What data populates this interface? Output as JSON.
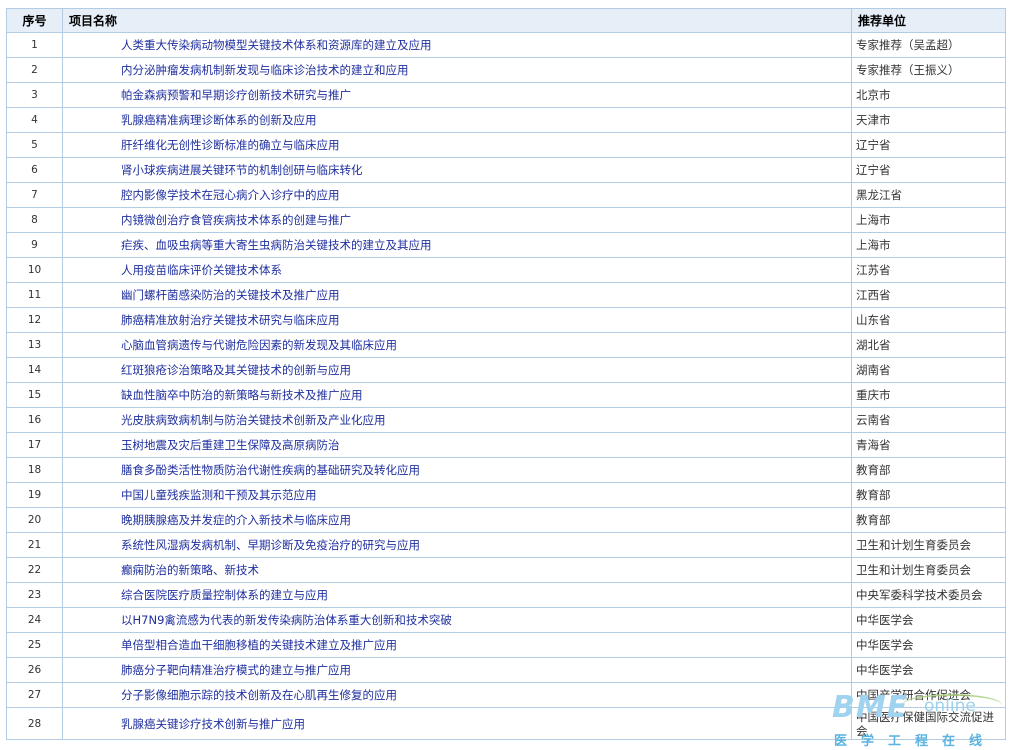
{
  "headers": {
    "no": "序号",
    "name": "项目名称",
    "unit": "推荐单位"
  },
  "rows": [
    {
      "no": "1",
      "name": "人类重大传染病动物模型关键技术体系和资源库的建立及应用",
      "unit": "专家推荐（吴孟超）"
    },
    {
      "no": "2",
      "name": "内分泌肿瘤发病机制新发现与临床诊治技术的建立和应用",
      "unit": "专家推荐（王振义）"
    },
    {
      "no": "3",
      "name": "帕金森病预警和早期诊疗创新技术研究与推广",
      "unit": "北京市"
    },
    {
      "no": "4",
      "name": "乳腺癌精准病理诊断体系的创新及应用",
      "unit": "天津市"
    },
    {
      "no": "5",
      "name": "肝纤维化无创性诊断标准的确立与临床应用",
      "unit": "辽宁省"
    },
    {
      "no": "6",
      "name": "肾小球疾病进展关键环节的机制创研与临床转化",
      "unit": "辽宁省"
    },
    {
      "no": "7",
      "name": "腔内影像学技术在冠心病介入诊疗中的应用",
      "unit": "黑龙江省"
    },
    {
      "no": "8",
      "name": "内镜微创治疗食管疾病技术体系的创建与推广",
      "unit": "上海市"
    },
    {
      "no": "9",
      "name": "疟疾、血吸虫病等重大寄生虫病防治关键技术的建立及其应用",
      "unit": "上海市"
    },
    {
      "no": "10",
      "name": "人用疫苗临床评价关键技术体系",
      "unit": "江苏省"
    },
    {
      "no": "11",
      "name": "幽门螺杆菌感染防治的关键技术及推广应用",
      "unit": "江西省"
    },
    {
      "no": "12",
      "name": "肺癌精准放射治疗关键技术研究与临床应用",
      "unit": "山东省"
    },
    {
      "no": "13",
      "name": "心脑血管病遗传与代谢危险因素的新发现及其临床应用",
      "unit": "湖北省"
    },
    {
      "no": "14",
      "name": "红斑狼疮诊治策略及其关键技术的创新与应用",
      "unit": "湖南省"
    },
    {
      "no": "15",
      "name": "缺血性脑卒中防治的新策略与新技术及推广应用",
      "unit": "重庆市"
    },
    {
      "no": "16",
      "name": "光皮肤病致病机制与防治关键技术创新及产业化应用",
      "unit": "云南省"
    },
    {
      "no": "17",
      "name": "玉树地震及灾后重建卫生保障及高原病防治",
      "unit": "青海省"
    },
    {
      "no": "18",
      "name": "膳食多酚类活性物质防治代谢性疾病的基础研究及转化应用",
      "unit": "教育部"
    },
    {
      "no": "19",
      "name": "中国儿童残疾监测和干预及其示范应用",
      "unit": "教育部"
    },
    {
      "no": "20",
      "name": "晚期胰腺癌及并发症的介入新技术与临床应用",
      "unit": "教育部"
    },
    {
      "no": "21",
      "name": "系统性风湿病发病机制、早期诊断及免疫治疗的研究与应用",
      "unit": "卫生和计划生育委员会"
    },
    {
      "no": "22",
      "name": "癫痫防治的新策略、新技术",
      "unit": "卫生和计划生育委员会"
    },
    {
      "no": "23",
      "name": "综合医院医疗质量控制体系的建立与应用",
      "unit": "中央军委科学技术委员会"
    },
    {
      "no": "24",
      "name": "以H7N9禽流感为代表的新发传染病防治体系重大创新和技术突破",
      "unit": "中华医学会"
    },
    {
      "no": "25",
      "name": "单倍型相合造血干细胞移植的关键技术建立及推广应用",
      "unit": "中华医学会"
    },
    {
      "no": "26",
      "name": "肺癌分子靶向精准治疗模式的建立与推广应用",
      "unit": "中华医学会"
    },
    {
      "no": "27",
      "name": "分子影像细胞示踪的技术创新及在心肌再生修复的应用",
      "unit": "中国产学研合作促进会"
    },
    {
      "no": "28",
      "name": "乳腺癌关键诊疗技术创新与推广应用",
      "unit": "中国医疗保健国际交流促进会"
    }
  ],
  "watermark": {
    "brand": "BME",
    "suffix": "online",
    "tagline": "医学工程在线"
  }
}
